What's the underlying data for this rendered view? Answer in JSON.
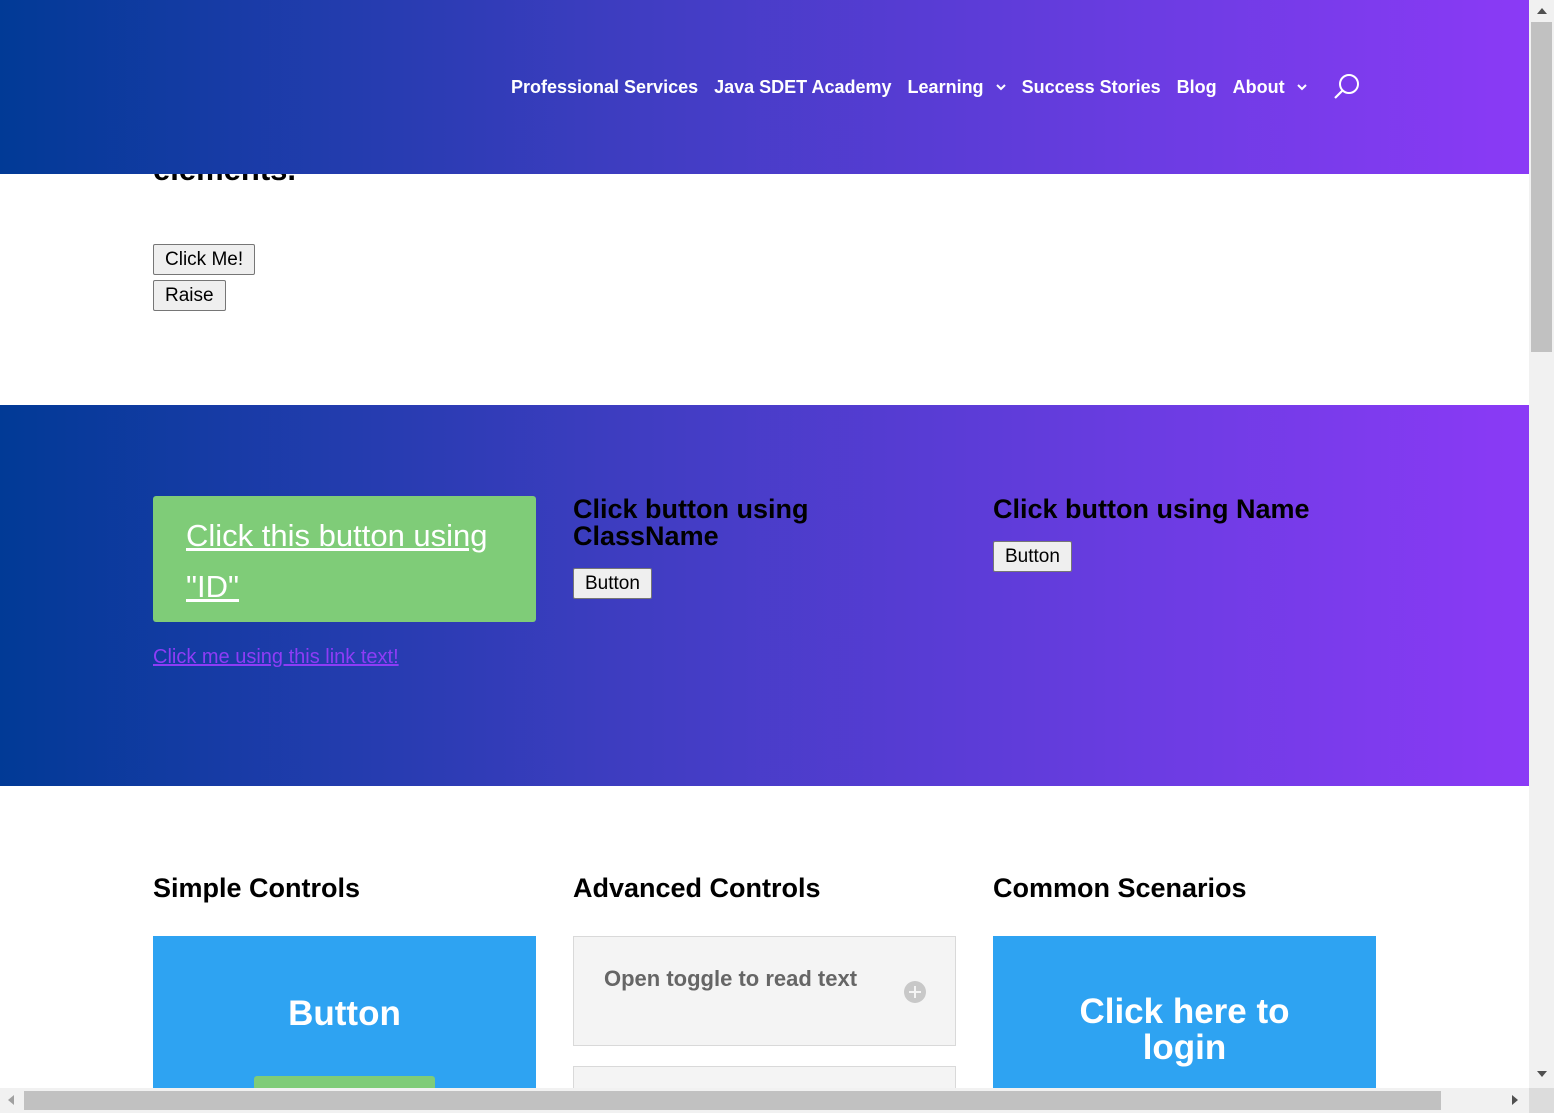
{
  "nav": {
    "items": [
      {
        "label": "Professional Services",
        "dropdown": false
      },
      {
        "label": "Java SDET Academy",
        "dropdown": false
      },
      {
        "label": "Learning",
        "dropdown": true
      },
      {
        "label": "Success Stories",
        "dropdown": false
      },
      {
        "label": "Blog",
        "dropdown": false
      },
      {
        "label": "About",
        "dropdown": true
      }
    ],
    "search_icon": "search-icon"
  },
  "top_section": {
    "heading_fragment": "elements.",
    "click_me_label": "Click Me!",
    "raise_label": "Raise"
  },
  "band": {
    "id_button_label": "Click this button using \"ID\"",
    "link_text": "Click me using this link text!",
    "classname_title": "Click button using ClassName",
    "classname_button": "Button",
    "name_title": "Click button using Name",
    "name_button": "Button"
  },
  "sections": {
    "simple_title": "Simple Controls",
    "simple_card_label": "Button",
    "advanced_title": "Advanced Controls",
    "toggle_label": "Open toggle to read text",
    "common_title": "Common Scenarios",
    "common_card_label": "Click here to login"
  },
  "colors": {
    "gradient_start": "#013a96",
    "gradient_end": "#8b3af6",
    "green_button": "#7fcc78",
    "blue_card": "#2ea3f2",
    "link": "#8e3cf6"
  }
}
